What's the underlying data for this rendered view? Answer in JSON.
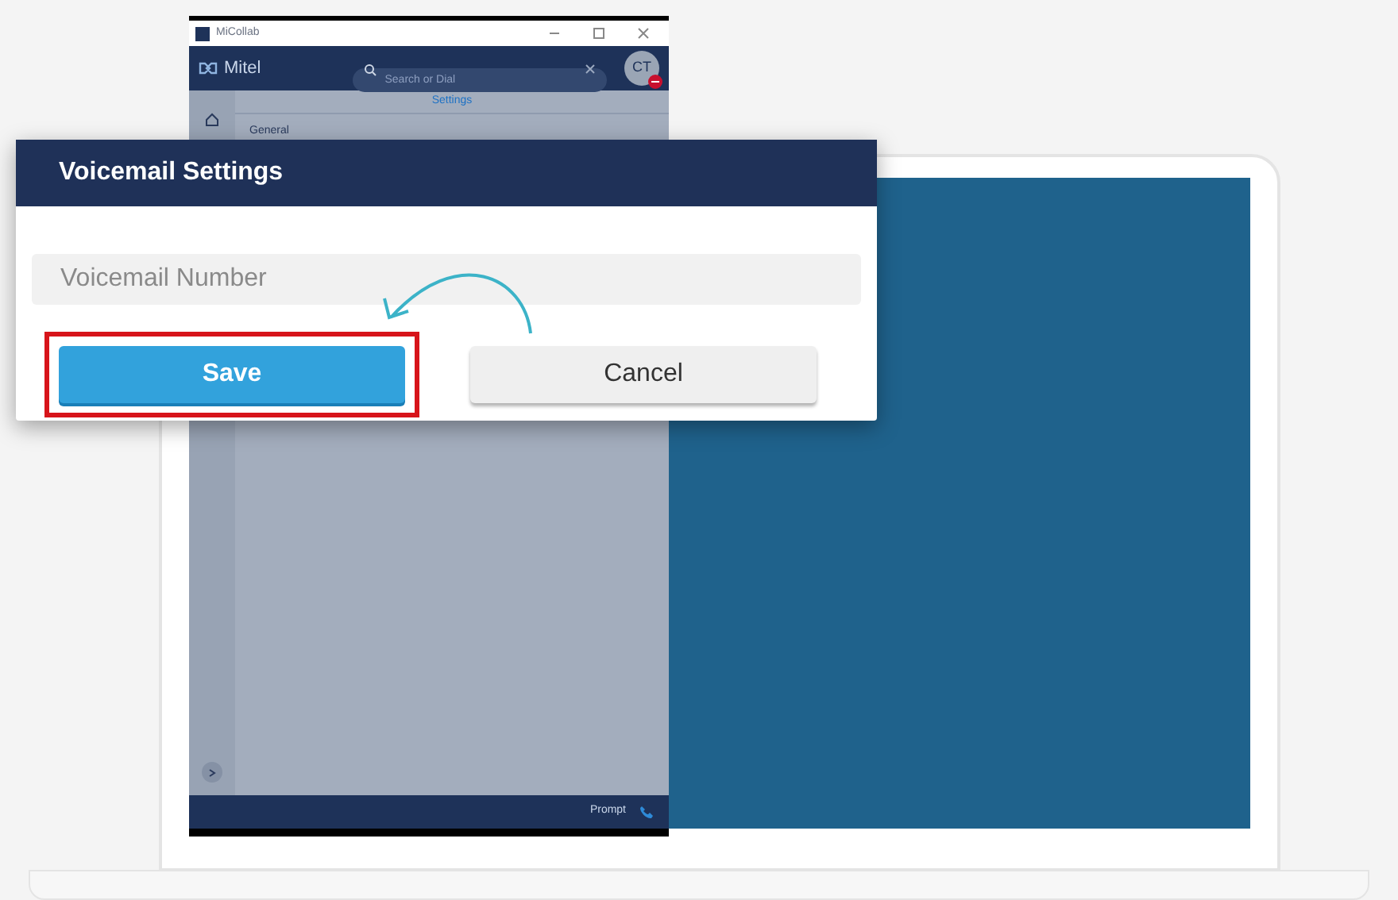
{
  "app_window": {
    "title": "MiCollab",
    "logo": "Mitel",
    "search": {
      "placeholder": "Search or Dial"
    },
    "avatar": "CT",
    "page_title": "Settings",
    "section": "General",
    "footer": {
      "status": "Prompt"
    }
  },
  "dialog": {
    "title": "Voicemail Settings",
    "field": {
      "placeholder": "Voicemail Number"
    },
    "buttons": [
      {
        "label": "Save",
        "kind": "primary",
        "highlighted": true
      },
      {
        "label": "Cancel",
        "kind": "secondary",
        "highlighted": false
      }
    ]
  }
}
